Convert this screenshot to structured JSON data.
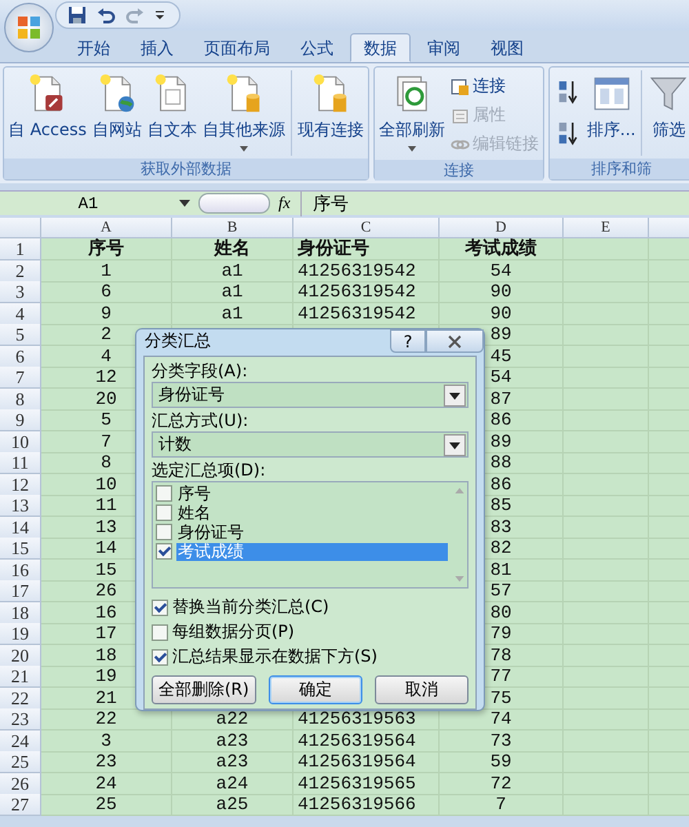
{
  "tabs": [
    {
      "label": "开始",
      "selected": false
    },
    {
      "label": "插入",
      "selected": false
    },
    {
      "label": "页面布局",
      "selected": false
    },
    {
      "label": "公式",
      "selected": false
    },
    {
      "label": "数据",
      "selected": true
    },
    {
      "label": "审阅",
      "selected": false
    },
    {
      "label": "视图",
      "selected": false
    }
  ],
  "ribbon_groups": [
    {
      "title": "获取外部数据",
      "items": [
        {
          "kind": "large",
          "label": "自 Access",
          "caret": false
        },
        {
          "kind": "large",
          "label": "自网站",
          "caret": false
        },
        {
          "kind": "large",
          "label": "自文本",
          "caret": false
        },
        {
          "kind": "large",
          "label": "自其他来源",
          "caret": true
        },
        {
          "kind": "separator"
        },
        {
          "kind": "large",
          "label": "现有连接",
          "caret": false
        }
      ]
    },
    {
      "title": "连接",
      "items": [
        {
          "kind": "large",
          "label": "全部刷新",
          "caret": true
        },
        {
          "kind": "stack",
          "entries": [
            {
              "label": "连接",
              "disabled": false
            },
            {
              "label": "属性",
              "disabled": true
            },
            {
              "label": "编辑链接",
              "disabled": true
            }
          ]
        }
      ]
    },
    {
      "title": "排序和筛",
      "items": [
        {
          "kind": "sort-pair"
        },
        {
          "kind": "large",
          "label": "排序...",
          "caret": false
        },
        {
          "kind": "separator"
        },
        {
          "kind": "large",
          "label": "筛选",
          "caret": false
        }
      ]
    }
  ],
  "formula_bar": {
    "name_box": "A1",
    "function_label": "fx",
    "formula": "序号"
  },
  "sheet": {
    "columns": [
      "A",
      "B",
      "C",
      "D",
      "E"
    ],
    "rows": [
      {
        "header": "1",
        "a": "序号",
        "b": "姓名",
        "c": "身份证号",
        "d": "考试成绩",
        "bold": true
      },
      {
        "header": "2",
        "a": "1",
        "b": "a1",
        "c": "41256319542",
        "d": "54",
        "bold": false
      },
      {
        "header": "3",
        "a": "6",
        "b": "a1",
        "c": "41256319542",
        "d": "90",
        "bold": false
      },
      {
        "header": "4",
        "a": "9",
        "b": "a1",
        "c": "41256319542",
        "d": "90",
        "bold": false
      },
      {
        "header": "5",
        "a": "2",
        "d": "89",
        "bold": false
      },
      {
        "header": "6",
        "a": "4",
        "d": "45",
        "bold": false
      },
      {
        "header": "7",
        "a": "12",
        "d": "54",
        "bold": false
      },
      {
        "header": "8",
        "a": "20",
        "d": "87",
        "bold": false
      },
      {
        "header": "9",
        "a": "5",
        "d": "86",
        "bold": false
      },
      {
        "header": "10",
        "a": "7",
        "d": "89",
        "bold": false
      },
      {
        "header": "11",
        "a": "8",
        "d": "88",
        "bold": false
      },
      {
        "header": "12",
        "a": "10",
        "d": "86",
        "bold": false
      },
      {
        "header": "13",
        "a": "11",
        "d": "85",
        "bold": false
      },
      {
        "header": "14",
        "a": "13",
        "d": "83",
        "bold": false
      },
      {
        "header": "15",
        "a": "14",
        "d": "82",
        "bold": false
      },
      {
        "header": "16",
        "a": "15",
        "d": "81",
        "bold": false
      },
      {
        "header": "17",
        "a": "26",
        "d": "57",
        "bold": false
      },
      {
        "header": "18",
        "a": "16",
        "d": "80",
        "bold": false
      },
      {
        "header": "19",
        "a": "17",
        "d": "79",
        "bold": false
      },
      {
        "header": "20",
        "a": "18",
        "d": "78",
        "bold": false
      },
      {
        "header": "21",
        "a": "19",
        "d": "77",
        "bold": false
      },
      {
        "header": "22",
        "a": "21",
        "d": "75",
        "bold": false
      },
      {
        "header": "23",
        "a": "22",
        "b": "a22",
        "c": "41256319563",
        "d": "74",
        "bold": false
      },
      {
        "header": "24",
        "a": "3",
        "b": "a23",
        "c": "41256319564",
        "d": "73",
        "bold": false
      },
      {
        "header": "25",
        "a": "23",
        "b": "a23",
        "c": "41256319564",
        "d": "59",
        "bold": false
      },
      {
        "header": "26",
        "a": "24",
        "b": "a24",
        "c": "41256319565",
        "d": "72",
        "bold": false
      },
      {
        "header": "27",
        "a": "25",
        "b": "a25",
        "c": "41256319566",
        "d": "7",
        "bold": false
      }
    ]
  },
  "dialog": {
    "title": "分类汇总",
    "help": "?",
    "group_by_label": "分类字段(A):",
    "group_by_value": "身份证号",
    "function_label": "汇总方式(U):",
    "function_value": "计数",
    "items_label": "选定汇总项(D):",
    "items": [
      {
        "label": "序号",
        "checked": false,
        "selected": false
      },
      {
        "label": "姓名",
        "checked": false,
        "selected": false
      },
      {
        "label": "身份证号",
        "checked": false,
        "selected": false
      },
      {
        "label": "考试成绩",
        "checked": true,
        "selected": true
      }
    ],
    "options": [
      {
        "label": "替换当前分类汇总(C)",
        "checked": true
      },
      {
        "label": "每组数据分页(P)",
        "checked": false
      },
      {
        "label": "汇总结果显示在数据下方(S)",
        "checked": true
      }
    ],
    "buttons": [
      {
        "label": "全部删除(R)",
        "default": false
      },
      {
        "label": "确定",
        "default": true
      },
      {
        "label": "取消",
        "default": false
      }
    ]
  }
}
